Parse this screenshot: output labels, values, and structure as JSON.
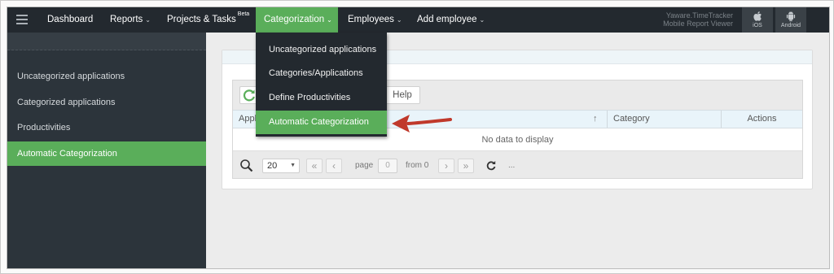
{
  "nav": {
    "items": [
      {
        "label": "Dashboard",
        "caret": false
      },
      {
        "label": "Reports",
        "caret": true
      },
      {
        "label": "Projects & Tasks",
        "badge": "Beta",
        "caret": false
      },
      {
        "label": "Categorization",
        "caret": true,
        "active": true
      },
      {
        "label": "Employees",
        "caret": true
      },
      {
        "label": "Add employee",
        "caret": true
      }
    ],
    "brand_line1": "Yaware.TimeTracker",
    "brand_line2": "Mobile Report Viewer",
    "ios_label": "iOS",
    "android_label": "Android"
  },
  "dropdown": {
    "items": [
      {
        "label": "Uncategorized applications"
      },
      {
        "label": "Categories/Applications"
      },
      {
        "label": "Define Productivities"
      },
      {
        "label": "Automatic Categorization",
        "active": true
      }
    ]
  },
  "sidebar": {
    "items": [
      {
        "label": "Uncategorized applications"
      },
      {
        "label": "Categorized applications"
      },
      {
        "label": "Productivities"
      },
      {
        "label": "Automatic Categorization",
        "active": true
      }
    ]
  },
  "grid": {
    "help_label": "Help",
    "columns": [
      "Application",
      "Category",
      "Actions"
    ],
    "empty_text": "No data to display",
    "page_size": "20",
    "page_label": "page",
    "page_value": "0",
    "from_label": "from 0",
    "ellipsis": "..."
  },
  "colors": {
    "accent": "#5aae5a",
    "nav_bg": "#23292f",
    "sidebar_bg": "#2c343b",
    "arrow": "#c0392b"
  }
}
